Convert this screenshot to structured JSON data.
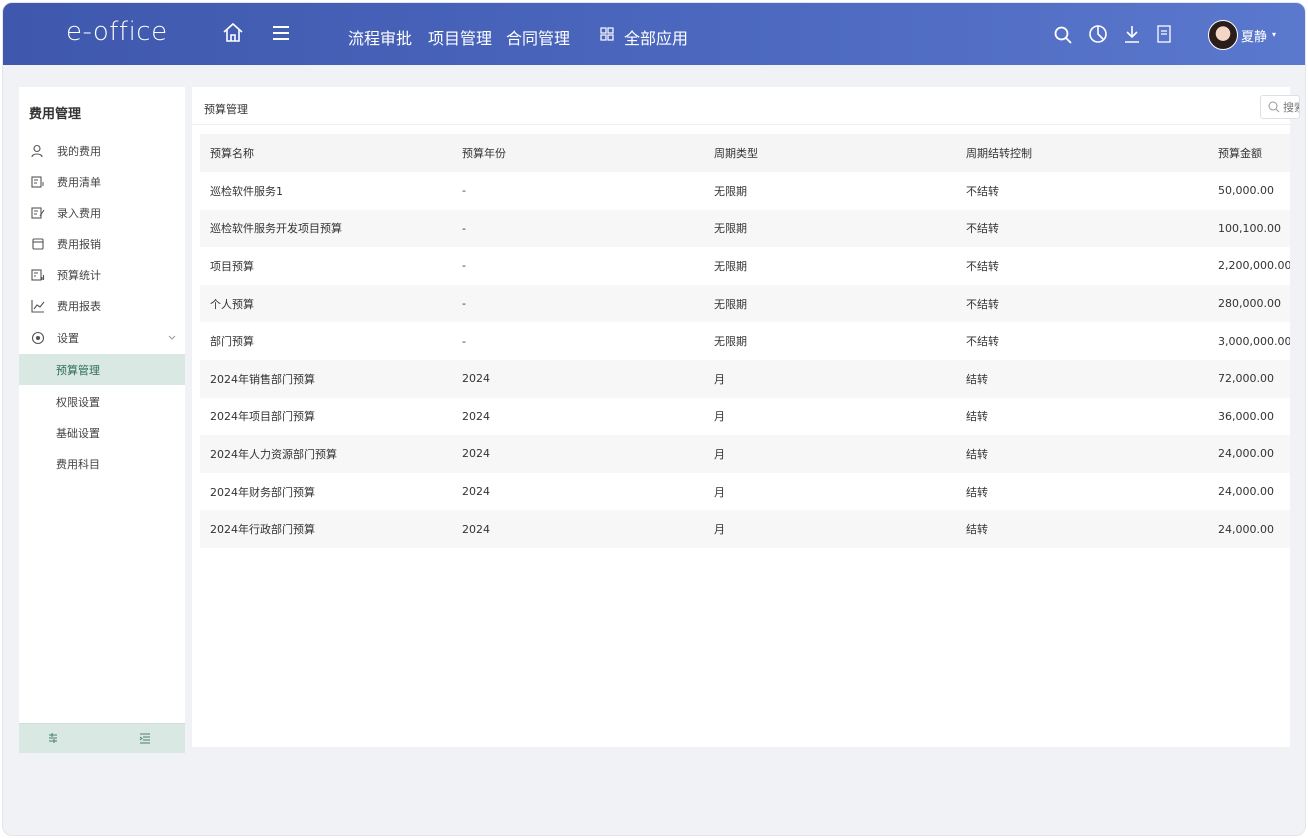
{
  "header": {
    "logo": "e-office",
    "nav": [
      "流程审批",
      "项目管理",
      "合同管理"
    ],
    "all_apps": "全部应用",
    "user_name": "夏静"
  },
  "sidebar": {
    "title": "费用管理",
    "items": [
      {
        "label": "我的费用",
        "icon": "user-icon"
      },
      {
        "label": "费用清单",
        "icon": "list-icon"
      },
      {
        "label": "录入费用",
        "icon": "edit-icon"
      },
      {
        "label": "费用报销",
        "icon": "wallet-icon"
      },
      {
        "label": "预算统计",
        "icon": "stats-icon"
      },
      {
        "label": "费用报表",
        "icon": "chart-line-icon"
      },
      {
        "label": "设置",
        "icon": "settings-icon"
      }
    ],
    "sub_items": [
      "预算管理",
      "权限设置",
      "基础设置",
      "费用科目"
    ],
    "active_sub": "预算管理"
  },
  "main": {
    "title": "预算管理",
    "search_placeholder": "搜索",
    "columns": [
      "预算名称",
      "预算年份",
      "周期类型",
      "周期结转控制",
      "预算金额"
    ],
    "rows": [
      [
        "巡检软件服务1",
        "-",
        "无限期",
        "不结转",
        "50,000.00"
      ],
      [
        "巡检软件服务开发项目预算",
        "-",
        "无限期",
        "不结转",
        "100,100.00"
      ],
      [
        "项目预算",
        "-",
        "无限期",
        "不结转",
        "2,200,000.00"
      ],
      [
        "个人预算",
        "-",
        "无限期",
        "不结转",
        "280,000.00"
      ],
      [
        "部门预算",
        "-",
        "无限期",
        "不结转",
        "3,000,000.00"
      ],
      [
        "2024年销售部门预算",
        "2024",
        "月",
        "结转",
        "72,000.00"
      ],
      [
        "2024年项目部门预算",
        "2024",
        "月",
        "结转",
        "36,000.00"
      ],
      [
        "2024年人力资源部门预算",
        "2024",
        "月",
        "结转",
        "24,000.00"
      ],
      [
        "2024年财务部门预算",
        "2024",
        "月",
        "结转",
        "24,000.00"
      ],
      [
        "2024年行政部门预算",
        "2024",
        "月",
        "结转",
        "24,000.00"
      ]
    ]
  },
  "colors": {
    "header": "#4a66bd",
    "active_bg": "#d9e8e3",
    "active_text": "#2f6d58"
  }
}
